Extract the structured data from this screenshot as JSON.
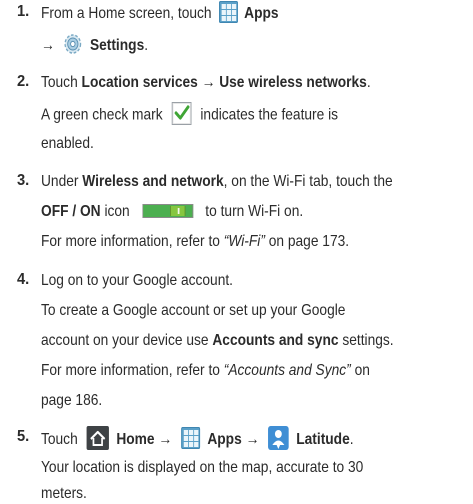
{
  "steps": [
    {
      "number": "1.",
      "lines": [
        {
          "pre": "From a Home screen, touch",
          "apps": "Apps"
        },
        {
          "arrow": "→",
          "settings": "Settings",
          "period": "."
        }
      ]
    },
    {
      "number": "2.",
      "lines": [
        {
          "pre": "Touch",
          "loc": "Location services",
          "arrow": "→",
          "wireless": "Use wireless networks",
          "period": "."
        },
        {
          "pre": "A green check mark",
          "post": "indicates the feature is"
        },
        {
          "text": "enabled."
        }
      ]
    },
    {
      "number": "3.",
      "lines": [
        {
          "pre": "Under",
          "bold": "Wireless and network",
          "post": ", on the Wi-Fi tab, touch the"
        },
        {
          "bold": "OFF / ON",
          "mid": "icon",
          "post": "to turn Wi-Fi on."
        },
        {
          "pre": "For more information, refer to",
          "ref": "“Wi-Fi”",
          "post": "on page 173."
        }
      ]
    },
    {
      "number": "4.",
      "lines": [
        {
          "text": "Log on to your Google account."
        },
        {
          "text": "To create a Google account or set up your Google"
        },
        {
          "pre": "account on your device use",
          "bold": "Accounts and sync",
          "post": "settings."
        },
        {
          "pre": "For more information, refer to",
          "ref": "“Accounts and Sync”",
          "post": "on"
        },
        {
          "text": "page 186."
        }
      ]
    },
    {
      "number": "5.",
      "lines": [
        {
          "pre": "Touch",
          "home": "Home",
          "arrow": "→",
          "apps": "Apps",
          "arrow2": "→",
          "latitude": "Latitude",
          "period": "."
        },
        {
          "text": "Your location is displayed on the map, accurate to 30"
        },
        {
          "text": "meters."
        }
      ]
    }
  ],
  "icons": {
    "apps": "apps-grid-icon",
    "settings": "settings-gear-icon",
    "check": "green-check-icon",
    "toggle": "wifi-toggle-icon",
    "home": "home-icon",
    "latitude": "latitude-icon"
  },
  "colors": {
    "text": "#2b2b2b",
    "apps_blue": "#5aa0c8",
    "check_green": "#3fa535",
    "toggle_green": "#86c640",
    "latitude_blue": "#3f8ed4"
  }
}
